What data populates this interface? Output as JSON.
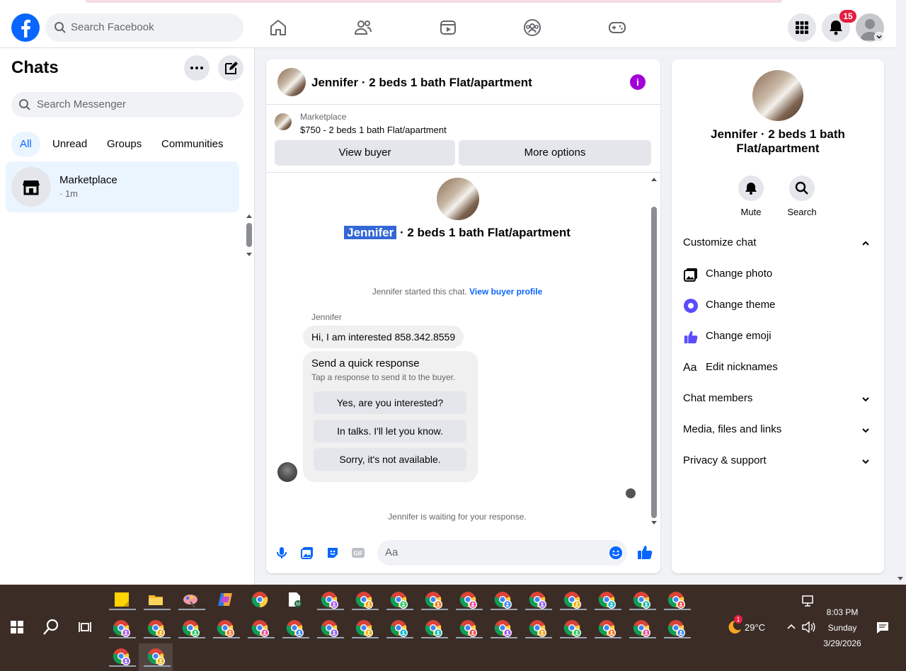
{
  "topbar": {
    "search_placeholder": "Search Facebook",
    "notification_count": "15",
    "nav_icons": [
      "home-icon",
      "friends-icon",
      "watch-icon",
      "groups-icon",
      "gaming-icon"
    ]
  },
  "left": {
    "title": "Chats",
    "search_placeholder": "Search Messenger",
    "tabs": [
      {
        "label": "All",
        "active": true
      },
      {
        "label": "Unread"
      },
      {
        "label": "Groups"
      },
      {
        "label": "Communities"
      }
    ],
    "chat_item": {
      "name": "Marketplace",
      "time": "· 1m"
    }
  },
  "middle": {
    "header_title": "Jennifer · 2 beds 1 bath Flat/apartment",
    "marketplace_label": "Marketplace",
    "marketplace_listing": "$750 - 2 beds 1 bath Flat/apartment",
    "view_buyer": "View buyer",
    "more_options": "More options",
    "conv_title_name": "Jennifer",
    "conv_title_rest": " · 2 beds 1 bath Flat/apartment",
    "started_text": "Jennifer started this chat. ",
    "view_buyer_profile": "View buyer profile",
    "sender_name": "Jennifer",
    "message": "Hi, I am interested 858.342.8559",
    "quick_response_title": "Send a quick response",
    "quick_response_sub": "Tap a response to send it to the buyer.",
    "quick_responses": [
      "Yes, are you interested?",
      "In talks. I'll let you know.",
      "Sorry, it's not available."
    ],
    "waiting_text": "Jennifer is waiting for your response.",
    "composer_placeholder": "Aa"
  },
  "right": {
    "title": "Jennifer · 2 beds 1 bath Flat/apartment",
    "mute": "Mute",
    "search": "Search",
    "customize_chat": "Customize chat",
    "change_photo": "Change photo",
    "change_theme": "Change theme",
    "change_emoji": "Change emoji",
    "edit_nicknames": "Edit nicknames",
    "nicknames_icon_text": "Aa",
    "chat_members": "Chat members",
    "media_files_links": "Media, files and links",
    "privacy_support": "Privacy & support"
  },
  "taskbar": {
    "weather_badge": "1",
    "temperature": "29°C",
    "time": "8:03 PM",
    "day": "Sunday",
    "date": "3/29/2026"
  },
  "colors": {
    "facebook_blue": "#0866ff",
    "highlight": "#3367d6",
    "info_purple": "#a100d8",
    "badge_red": "#e41e3f",
    "theme_purple": "#5b4cff"
  }
}
